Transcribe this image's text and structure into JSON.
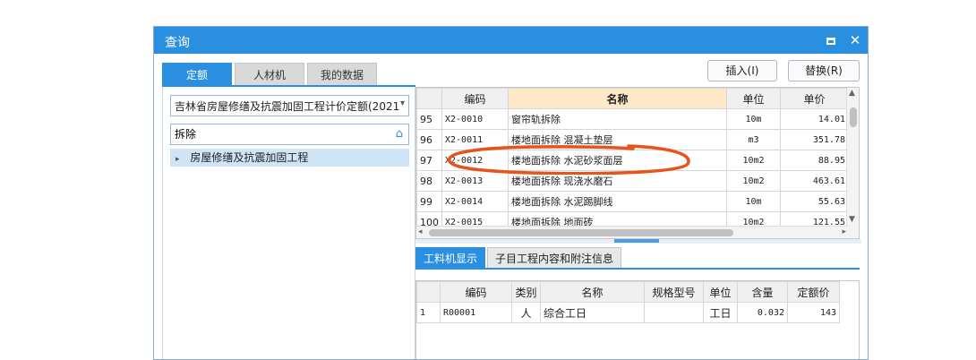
{
  "window": {
    "title": "查询"
  },
  "left": {
    "tabs": [
      "定额",
      "人材机",
      "我的数据"
    ],
    "library": "吉林省房屋修缮及抗震加固工程计价定额(2021",
    "search_value": "拆除",
    "tree_item": "房屋修缮及抗震加固工程"
  },
  "buttons": {
    "insert": "插入(I)",
    "replace": "替换(R)"
  },
  "quota_table": {
    "headers": [
      "",
      "编码",
      "名称",
      "单位",
      "单价"
    ],
    "rows": [
      [
        "95",
        "X2-0010",
        "窗帘轨拆除",
        "10m",
        "14.01"
      ],
      [
        "96",
        "X2-0011",
        "楼地面拆除 混凝土垫层",
        "m3",
        "351.78"
      ],
      [
        "97",
        "X2-0012",
        "楼地面拆除 水泥砂浆面层",
        "10m2",
        "88.95"
      ],
      [
        "98",
        "X2-0013",
        "楼地面拆除 现浇水磨石",
        "10m2",
        "463.61"
      ],
      [
        "99",
        "X2-0014",
        "楼地面拆除 水泥踢脚线",
        "10m",
        "55.63"
      ],
      [
        "100",
        "X2-0015",
        "楼地面拆除 地面砖",
        "10m2",
        "121.55"
      ]
    ]
  },
  "lower_tabs": [
    "工料机显示",
    "子目工程内容和附注信息"
  ],
  "resource_table": {
    "headers": [
      "",
      "编码",
      "类别",
      "名称",
      "规格型号",
      "单位",
      "含量",
      "定额价"
    ],
    "rows": [
      [
        "1",
        "R00001",
        "人",
        "综合工日",
        "",
        "工日",
        "0.032",
        "143"
      ]
    ]
  },
  "colors": {
    "accent": "#2a8fe0",
    "annotation": "#e8531a"
  }
}
